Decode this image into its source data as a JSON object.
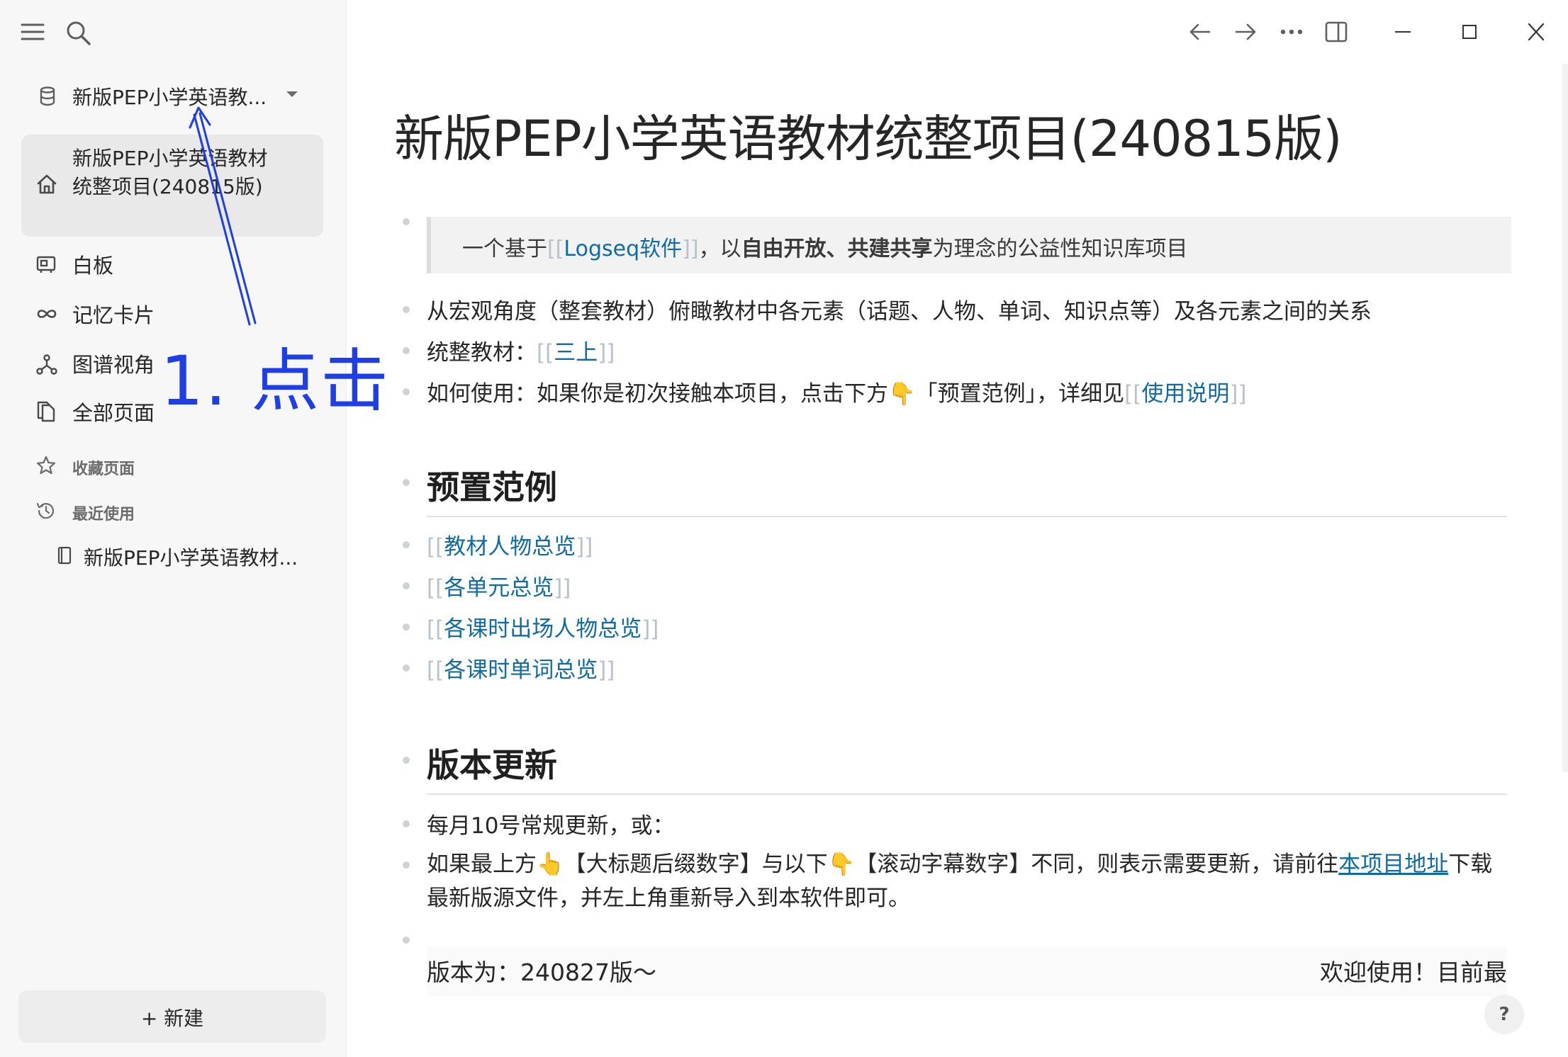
{
  "sidebar": {
    "graph_name": "新版PEP小学英语教...",
    "nav": {
      "home_label": "新版PEP小学英语教材统整项目(240815版)",
      "whiteboard": "白板",
      "flashcards": "记忆卡片",
      "graph_view": "图谱视角",
      "all_pages": "全部页面"
    },
    "favorites_label": "收藏页面",
    "recent_label": "最近使用",
    "recent_page": "新版PEP小学英语教材...",
    "new_button": "+ 新建"
  },
  "annotation": {
    "text": "1. 点击",
    "color": "#1e3ee6"
  },
  "page": {
    "title": "新版PEP小学英语教材统整项目(240815版)",
    "quote": {
      "prefix": "一个基于",
      "link": "Logseq软件",
      "middle": "，以",
      "bold": "自由开放、共建共享",
      "suffix": "为理念的公益性知识库项目"
    },
    "intro_line": "从宏观角度（整套教材）俯瞰教材中各元素（话题、人物、单词、知识点等）及各元素之间的关系",
    "compiled_prefix": "统整教材：",
    "compiled_link": "三上",
    "howto_prefix": "如何使用：如果你是初次接触本项目，点击下方👇「预置范例」，详细见",
    "howto_link": "使用说明",
    "preset_heading": "预置范例",
    "preset_links": [
      "教材人物总览",
      "各单元总览",
      "各课时出场人物总览",
      "各课时单词总览"
    ],
    "update_heading": "版本更新",
    "update_line1": "每月10号常规更新，或：",
    "update_line2_prefix": "如果最上方👆【大标题后缀数字】与以下👇【滚动字幕数字】不同，则表示需要更新，请前往",
    "update_line2_link": "本项目地址",
    "update_line2_suffix": "下载最新版源文件，并左上角重新导入到本软件即可。",
    "version_left": "版本为：240827版～",
    "version_right": "欢迎使用！目前最",
    "help_label": "?"
  },
  "colors": {
    "link": "#106ba3",
    "sidebar_bg": "#f7f7f7",
    "active_bg": "#e9e9e9"
  }
}
